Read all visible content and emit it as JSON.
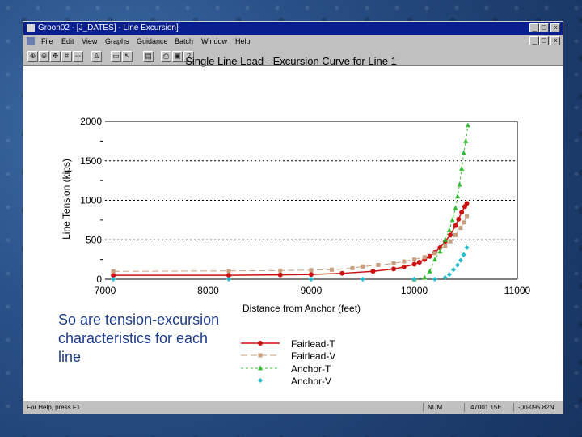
{
  "window": {
    "title": "Groon02 - [J_DATES] - Line Excursion]",
    "menu": [
      "File",
      "Edit",
      "View",
      "Graphs",
      "Guidance",
      "Batch",
      "Window",
      "Help"
    ],
    "status": {
      "help": "For Help, press F1",
      "num": "NUM",
      "coord1": "47001.15E",
      "coord2": "-00-095.82N"
    }
  },
  "caption": {
    "line1": "So are tension-excursion",
    "line2": "characteristics for each",
    "line3": "line"
  },
  "colors": {
    "fairlead_t": "#cc1111",
    "fairlead_v": "#c8a080",
    "anchor_t": "#33bb33",
    "anchor_v": "#22bbcc"
  },
  "chart_data": {
    "type": "line",
    "title": "Single Line Load - Excursion Curve for Line  1",
    "xlabel": "Distance from Anchor (feet)",
    "ylabel": "Line Tension (kips)",
    "xlim": [
      7000,
      11000
    ],
    "ylim": [
      0,
      2000
    ],
    "x_ticks": [
      "7000",
      "8000",
      "9000",
      "10000",
      "11000"
    ],
    "y_ticks": [
      "0",
      "500",
      "1000",
      "1500",
      "2000"
    ],
    "grid": "dashed horizontal",
    "legend_position": "below-right",
    "series": [
      {
        "name": "Fairlead-T",
        "x": [
          7080,
          8200,
          8700,
          9000,
          9300,
          9600,
          9800,
          9900,
          10000,
          10050,
          10100,
          10150,
          10200,
          10250,
          10300,
          10350,
          10400,
          10430,
          10460,
          10490,
          10510
        ],
        "y": [
          50,
          50,
          55,
          60,
          75,
          100,
          130,
          155,
          190,
          215,
          250,
          290,
          340,
          400,
          480,
          560,
          680,
          760,
          850,
          920,
          960
        ]
      },
      {
        "name": "Fairlead-V",
        "x": [
          7080,
          8200,
          8700,
          9000,
          9200,
          9400,
          9500,
          9650,
          9800,
          9900,
          10000,
          10100,
          10200,
          10300,
          10350,
          10400,
          10450,
          10480,
          10510
        ],
        "y": [
          100,
          105,
          110,
          115,
          120,
          140,
          160,
          180,
          200,
          225,
          250,
          280,
          330,
          420,
          480,
          560,
          650,
          720,
          800
        ]
      },
      {
        "name": "Anchor-T",
        "x": [
          10000,
          10100,
          10150,
          10200,
          10250,
          10300,
          10340,
          10370,
          10400,
          10420,
          10440,
          10460,
          10480,
          10500,
          10520
        ],
        "y": [
          0,
          20,
          100,
          250,
          350,
          500,
          620,
          750,
          900,
          1050,
          1200,
          1400,
          1600,
          1750,
          1950
        ]
      },
      {
        "name": "Anchor-V",
        "x": [
          7080,
          8200,
          9000,
          9500,
          10000,
          10200,
          10300,
          10340,
          10380,
          10420,
          10450,
          10480,
          10510
        ],
        "y": [
          0,
          0,
          0,
          0,
          0,
          0,
          20,
          60,
          120,
          180,
          240,
          310,
          400
        ]
      }
    ]
  }
}
